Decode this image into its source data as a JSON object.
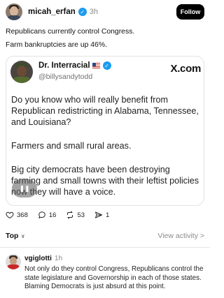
{
  "post": {
    "username": "micah_erfan",
    "time": "3h",
    "follow_label": "Follow",
    "line1": "Republicans currently control Congress.",
    "line2": "Farm bankruptcies are up 46%."
  },
  "quote": {
    "display_name": "Dr. Interracial",
    "handle": "@billysandytodd",
    "source": "X.com",
    "paragraph1": "Do you know who will really benefit from Republican redistricting in Alabama, Tennessee, and Louisiana?",
    "paragraph2": "Farmers and small rural areas.",
    "paragraph3": "Big city democrats have been destroying farming and small towns with their leftist policies now they will have a voice."
  },
  "actions": {
    "likes": "368",
    "replies": "16",
    "reposts": "53",
    "shares": "1"
  },
  "sort": {
    "label": "Top",
    "view_activity": "View activity >"
  },
  "comment": {
    "username": "vgiglotti",
    "time": "1h",
    "text": "Not only do they control Congress, Republicans control the state legislature and Governorship in each of those states. Blaming Democrats is just absurd at this point."
  },
  "colors": {
    "verified": "#1d9bf0",
    "follow_bg": "#000000",
    "muted": "#8a8a8a"
  }
}
